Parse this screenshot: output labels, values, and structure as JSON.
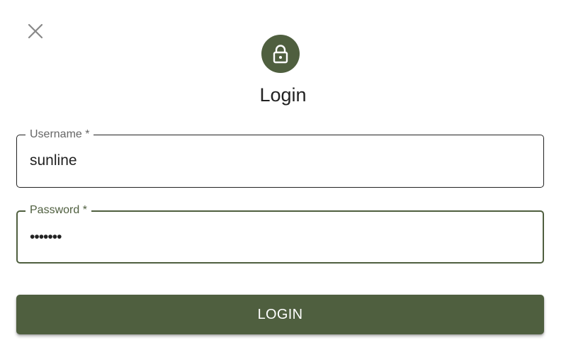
{
  "dialog": {
    "close_icon": "close-icon",
    "avatar_icon": "lock-icon",
    "title": "Login"
  },
  "form": {
    "username": {
      "label": "Username *",
      "value": "sunline"
    },
    "password": {
      "label": "Password *",
      "value": "•••••••"
    },
    "submit_label": "LOGIN"
  },
  "colors": {
    "accent": "#4f5f3f",
    "text": "#222222",
    "label_muted": "#666666",
    "close_icon": "#888888"
  }
}
